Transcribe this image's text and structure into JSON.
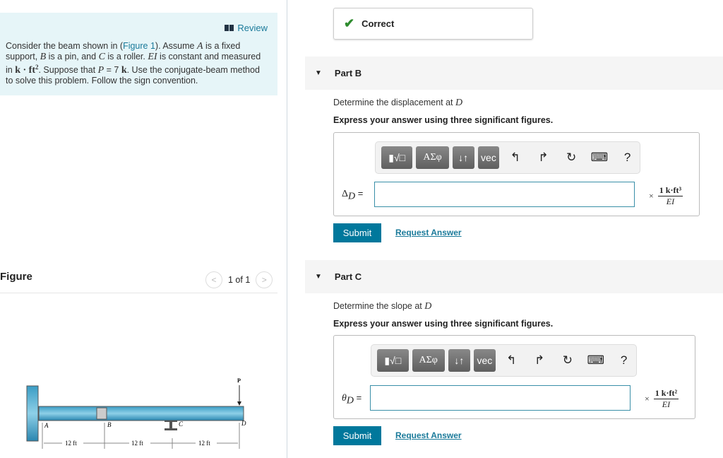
{
  "review": {
    "label": "Review",
    "icon": "book-icon"
  },
  "problem": {
    "t1": "Consider the beam shown in (",
    "link": "Figure 1",
    "t2": "). Assume ",
    "A": "A",
    "t3": " is a fixed support, ",
    "B": "B",
    "t4": " is a pin, and ",
    "C": "C",
    "t5": " is a roller. ",
    "EI": "EI",
    "t6": " is constant and measured in ",
    "unit": "k · ft",
    "sup": "2",
    "t7": ". Suppose that ",
    "P": "P",
    "t8": " = 7 ",
    "k": "k",
    "t9": ". Use the conjugate-beam method to solve this problem. Follow the sign convention."
  },
  "figure": {
    "title": "Figure",
    "pager": "1 of 1",
    "labels": {
      "A": "A",
      "B": "B",
      "C": "C",
      "D": "D",
      "P": "P"
    },
    "dims": [
      "12 ft",
      "12 ft",
      "12 ft"
    ]
  },
  "status": {
    "label": "Correct",
    "color": "#2e8b2e"
  },
  "partB": {
    "title": "Part B",
    "question": "Determine the displacement at ",
    "qvar": "D",
    "instr": "Express your answer using three significant figures.",
    "var_label": "Δ",
    "var_sub": "D",
    "eq": " =",
    "unit_num": "1 k·ft³",
    "unit_den": "EI",
    "times": "×",
    "submit": "Submit",
    "request": "Request Answer"
  },
  "partC": {
    "title": "Part C",
    "question": "Determine the slope at ",
    "qvar": "D",
    "instr": "Express your answer using three significant figures.",
    "var_label": "θ",
    "var_sub": "D",
    "eq": " =",
    "unit_num": "1 k·ft²",
    "unit_den": "EI",
    "times": "×",
    "submit": "Submit",
    "request": "Request Answer"
  },
  "toolbar": {
    "templates": "▮√□",
    "greek": "ΑΣφ",
    "arrows": "↓↑",
    "vec": "vec",
    "undo": "↰",
    "redo": "↱",
    "reset": "↻",
    "keyboard": "⌨",
    "help": "?"
  },
  "colors": {
    "accent": "#00789c",
    "link": "#1a7a9a",
    "review_bg": "#e6f5f8"
  }
}
